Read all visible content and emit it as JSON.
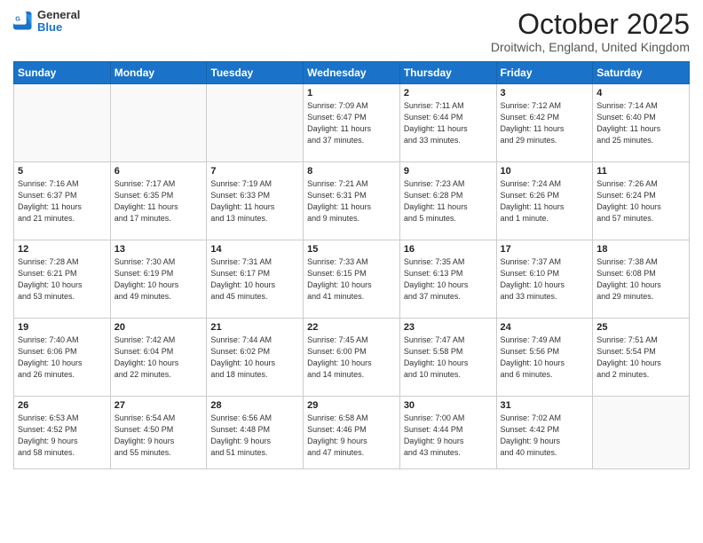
{
  "header": {
    "logo_general": "General",
    "logo_blue": "Blue",
    "month_title": "October 2025",
    "location": "Droitwich, England, United Kingdom"
  },
  "weekdays": [
    "Sunday",
    "Monday",
    "Tuesday",
    "Wednesday",
    "Thursday",
    "Friday",
    "Saturday"
  ],
  "weeks": [
    [
      {
        "day": "",
        "info": ""
      },
      {
        "day": "",
        "info": ""
      },
      {
        "day": "",
        "info": ""
      },
      {
        "day": "1",
        "info": "Sunrise: 7:09 AM\nSunset: 6:47 PM\nDaylight: 11 hours\nand 37 minutes."
      },
      {
        "day": "2",
        "info": "Sunrise: 7:11 AM\nSunset: 6:44 PM\nDaylight: 11 hours\nand 33 minutes."
      },
      {
        "day": "3",
        "info": "Sunrise: 7:12 AM\nSunset: 6:42 PM\nDaylight: 11 hours\nand 29 minutes."
      },
      {
        "day": "4",
        "info": "Sunrise: 7:14 AM\nSunset: 6:40 PM\nDaylight: 11 hours\nand 25 minutes."
      }
    ],
    [
      {
        "day": "5",
        "info": "Sunrise: 7:16 AM\nSunset: 6:37 PM\nDaylight: 11 hours\nand 21 minutes."
      },
      {
        "day": "6",
        "info": "Sunrise: 7:17 AM\nSunset: 6:35 PM\nDaylight: 11 hours\nand 17 minutes."
      },
      {
        "day": "7",
        "info": "Sunrise: 7:19 AM\nSunset: 6:33 PM\nDaylight: 11 hours\nand 13 minutes."
      },
      {
        "day": "8",
        "info": "Sunrise: 7:21 AM\nSunset: 6:31 PM\nDaylight: 11 hours\nand 9 minutes."
      },
      {
        "day": "9",
        "info": "Sunrise: 7:23 AM\nSunset: 6:28 PM\nDaylight: 11 hours\nand 5 minutes."
      },
      {
        "day": "10",
        "info": "Sunrise: 7:24 AM\nSunset: 6:26 PM\nDaylight: 11 hours\nand 1 minute."
      },
      {
        "day": "11",
        "info": "Sunrise: 7:26 AM\nSunset: 6:24 PM\nDaylight: 10 hours\nand 57 minutes."
      }
    ],
    [
      {
        "day": "12",
        "info": "Sunrise: 7:28 AM\nSunset: 6:21 PM\nDaylight: 10 hours\nand 53 minutes."
      },
      {
        "day": "13",
        "info": "Sunrise: 7:30 AM\nSunset: 6:19 PM\nDaylight: 10 hours\nand 49 minutes."
      },
      {
        "day": "14",
        "info": "Sunrise: 7:31 AM\nSunset: 6:17 PM\nDaylight: 10 hours\nand 45 minutes."
      },
      {
        "day": "15",
        "info": "Sunrise: 7:33 AM\nSunset: 6:15 PM\nDaylight: 10 hours\nand 41 minutes."
      },
      {
        "day": "16",
        "info": "Sunrise: 7:35 AM\nSunset: 6:13 PM\nDaylight: 10 hours\nand 37 minutes."
      },
      {
        "day": "17",
        "info": "Sunrise: 7:37 AM\nSunset: 6:10 PM\nDaylight: 10 hours\nand 33 minutes."
      },
      {
        "day": "18",
        "info": "Sunrise: 7:38 AM\nSunset: 6:08 PM\nDaylight: 10 hours\nand 29 minutes."
      }
    ],
    [
      {
        "day": "19",
        "info": "Sunrise: 7:40 AM\nSunset: 6:06 PM\nDaylight: 10 hours\nand 26 minutes."
      },
      {
        "day": "20",
        "info": "Sunrise: 7:42 AM\nSunset: 6:04 PM\nDaylight: 10 hours\nand 22 minutes."
      },
      {
        "day": "21",
        "info": "Sunrise: 7:44 AM\nSunset: 6:02 PM\nDaylight: 10 hours\nand 18 minutes."
      },
      {
        "day": "22",
        "info": "Sunrise: 7:45 AM\nSunset: 6:00 PM\nDaylight: 10 hours\nand 14 minutes."
      },
      {
        "day": "23",
        "info": "Sunrise: 7:47 AM\nSunset: 5:58 PM\nDaylight: 10 hours\nand 10 minutes."
      },
      {
        "day": "24",
        "info": "Sunrise: 7:49 AM\nSunset: 5:56 PM\nDaylight: 10 hours\nand 6 minutes."
      },
      {
        "day": "25",
        "info": "Sunrise: 7:51 AM\nSunset: 5:54 PM\nDaylight: 10 hours\nand 2 minutes."
      }
    ],
    [
      {
        "day": "26",
        "info": "Sunrise: 6:53 AM\nSunset: 4:52 PM\nDaylight: 9 hours\nand 58 minutes."
      },
      {
        "day": "27",
        "info": "Sunrise: 6:54 AM\nSunset: 4:50 PM\nDaylight: 9 hours\nand 55 minutes."
      },
      {
        "day": "28",
        "info": "Sunrise: 6:56 AM\nSunset: 4:48 PM\nDaylight: 9 hours\nand 51 minutes."
      },
      {
        "day": "29",
        "info": "Sunrise: 6:58 AM\nSunset: 4:46 PM\nDaylight: 9 hours\nand 47 minutes."
      },
      {
        "day": "30",
        "info": "Sunrise: 7:00 AM\nSunset: 4:44 PM\nDaylight: 9 hours\nand 43 minutes."
      },
      {
        "day": "31",
        "info": "Sunrise: 7:02 AM\nSunset: 4:42 PM\nDaylight: 9 hours\nand 40 minutes."
      },
      {
        "day": "",
        "info": ""
      }
    ]
  ]
}
